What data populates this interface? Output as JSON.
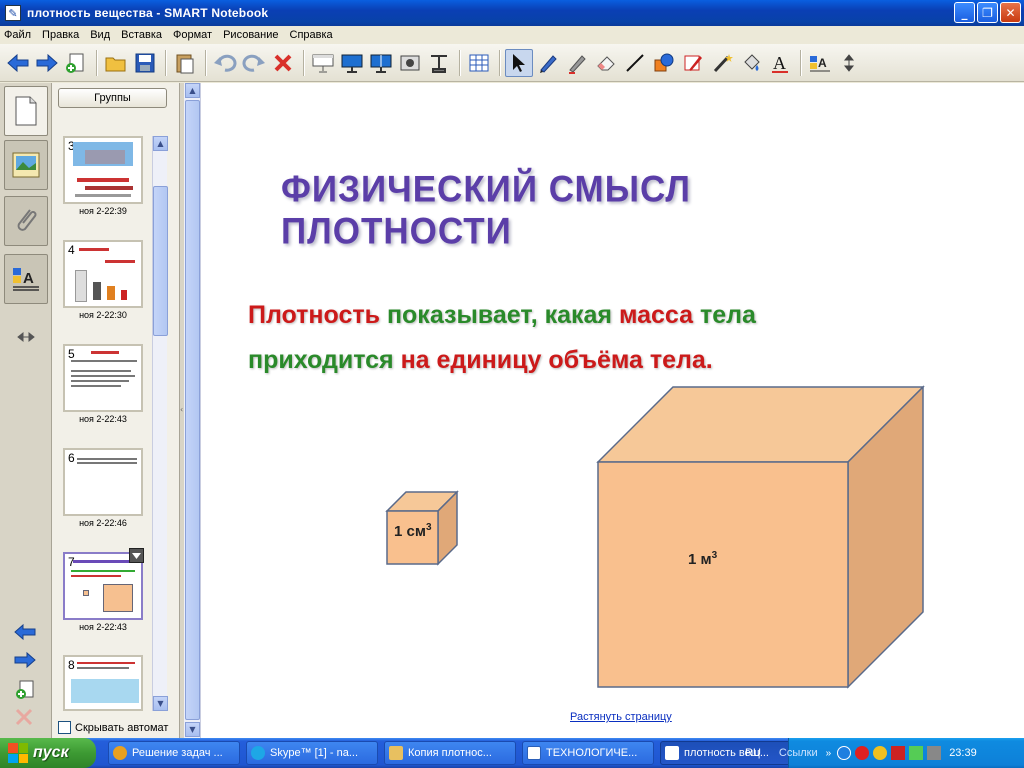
{
  "window": {
    "title": "плотность вещества - SMART Notebook"
  },
  "menu": [
    "Файл",
    "Правка",
    "Вид",
    "Вставка",
    "Формат",
    "Рисование",
    "Справка"
  ],
  "toolbar": {
    "icons": [
      "back-arrow-icon",
      "forward-arrow-icon",
      "add-page-icon",
      "open-folder-icon",
      "save-icon",
      "paste-icon",
      "undo-icon",
      "redo-icon",
      "delete-icon",
      "screen-shade-icon",
      "full-screen-icon",
      "dual-page-icon",
      "screen-capture-icon",
      "document-camera-icon",
      "table-icon",
      "select-pointer-icon",
      "pen-icon",
      "creative-pen-icon",
      "eraser-icon",
      "line-icon",
      "shapes-icon",
      "magic-pen-icon",
      "wand-icon",
      "fill-icon",
      "text-icon",
      "properties-icon",
      "move-toolbar-icon"
    ],
    "colors": {
      "accent_blue": "#2a6ad8",
      "red": "#d9302a",
      "active_bg": "#c8d7ee"
    }
  },
  "sidebar": {
    "groups_button": "Группы",
    "autohide_label": "Скрывать автомат",
    "thumbnails": [
      {
        "num": "3",
        "time": "ноя 2-22:39"
      },
      {
        "num": "4",
        "time": "ноя 2-22:30"
      },
      {
        "num": "5",
        "time": "ноя 2-22:43"
      },
      {
        "num": "6",
        "time": "ноя 2-22:46"
      },
      {
        "num": "7",
        "time": "ноя 2-22:43"
      },
      {
        "num": "8",
        "time": ""
      }
    ]
  },
  "slide": {
    "title": "ФИЗИЧЕСКИЙ СМЫСЛ ПЛОТНОСТИ",
    "line1": {
      "w1": "Плотность",
      "w2": "показывает, какая",
      "w3": "масса",
      "w4": "тела"
    },
    "line2": {
      "w1": "приходится",
      "w2": "на единицу объёма тела."
    },
    "small_cube_label": "1 см",
    "big_cube_label": "1 м",
    "exponent": "3",
    "stretch_link": "Растянуть страницу"
  },
  "taskbar": {
    "start": "пуск",
    "tasks": [
      {
        "label": "Решение задач ...",
        "color": "#e8a020"
      },
      {
        "label": "Skype™ [1] - na...",
        "color": "#1ea7e6"
      },
      {
        "label": "Копия плотнос...",
        "color": "#e8c060"
      },
      {
        "label": "ТЕХНОЛОГИЧЕ...",
        "color": "#2b5fb8"
      },
      {
        "label": "плотность вещ...",
        "color": "#ffffff"
      }
    ],
    "lang": "RU",
    "links": "Ссылки",
    "time": "23:39"
  }
}
